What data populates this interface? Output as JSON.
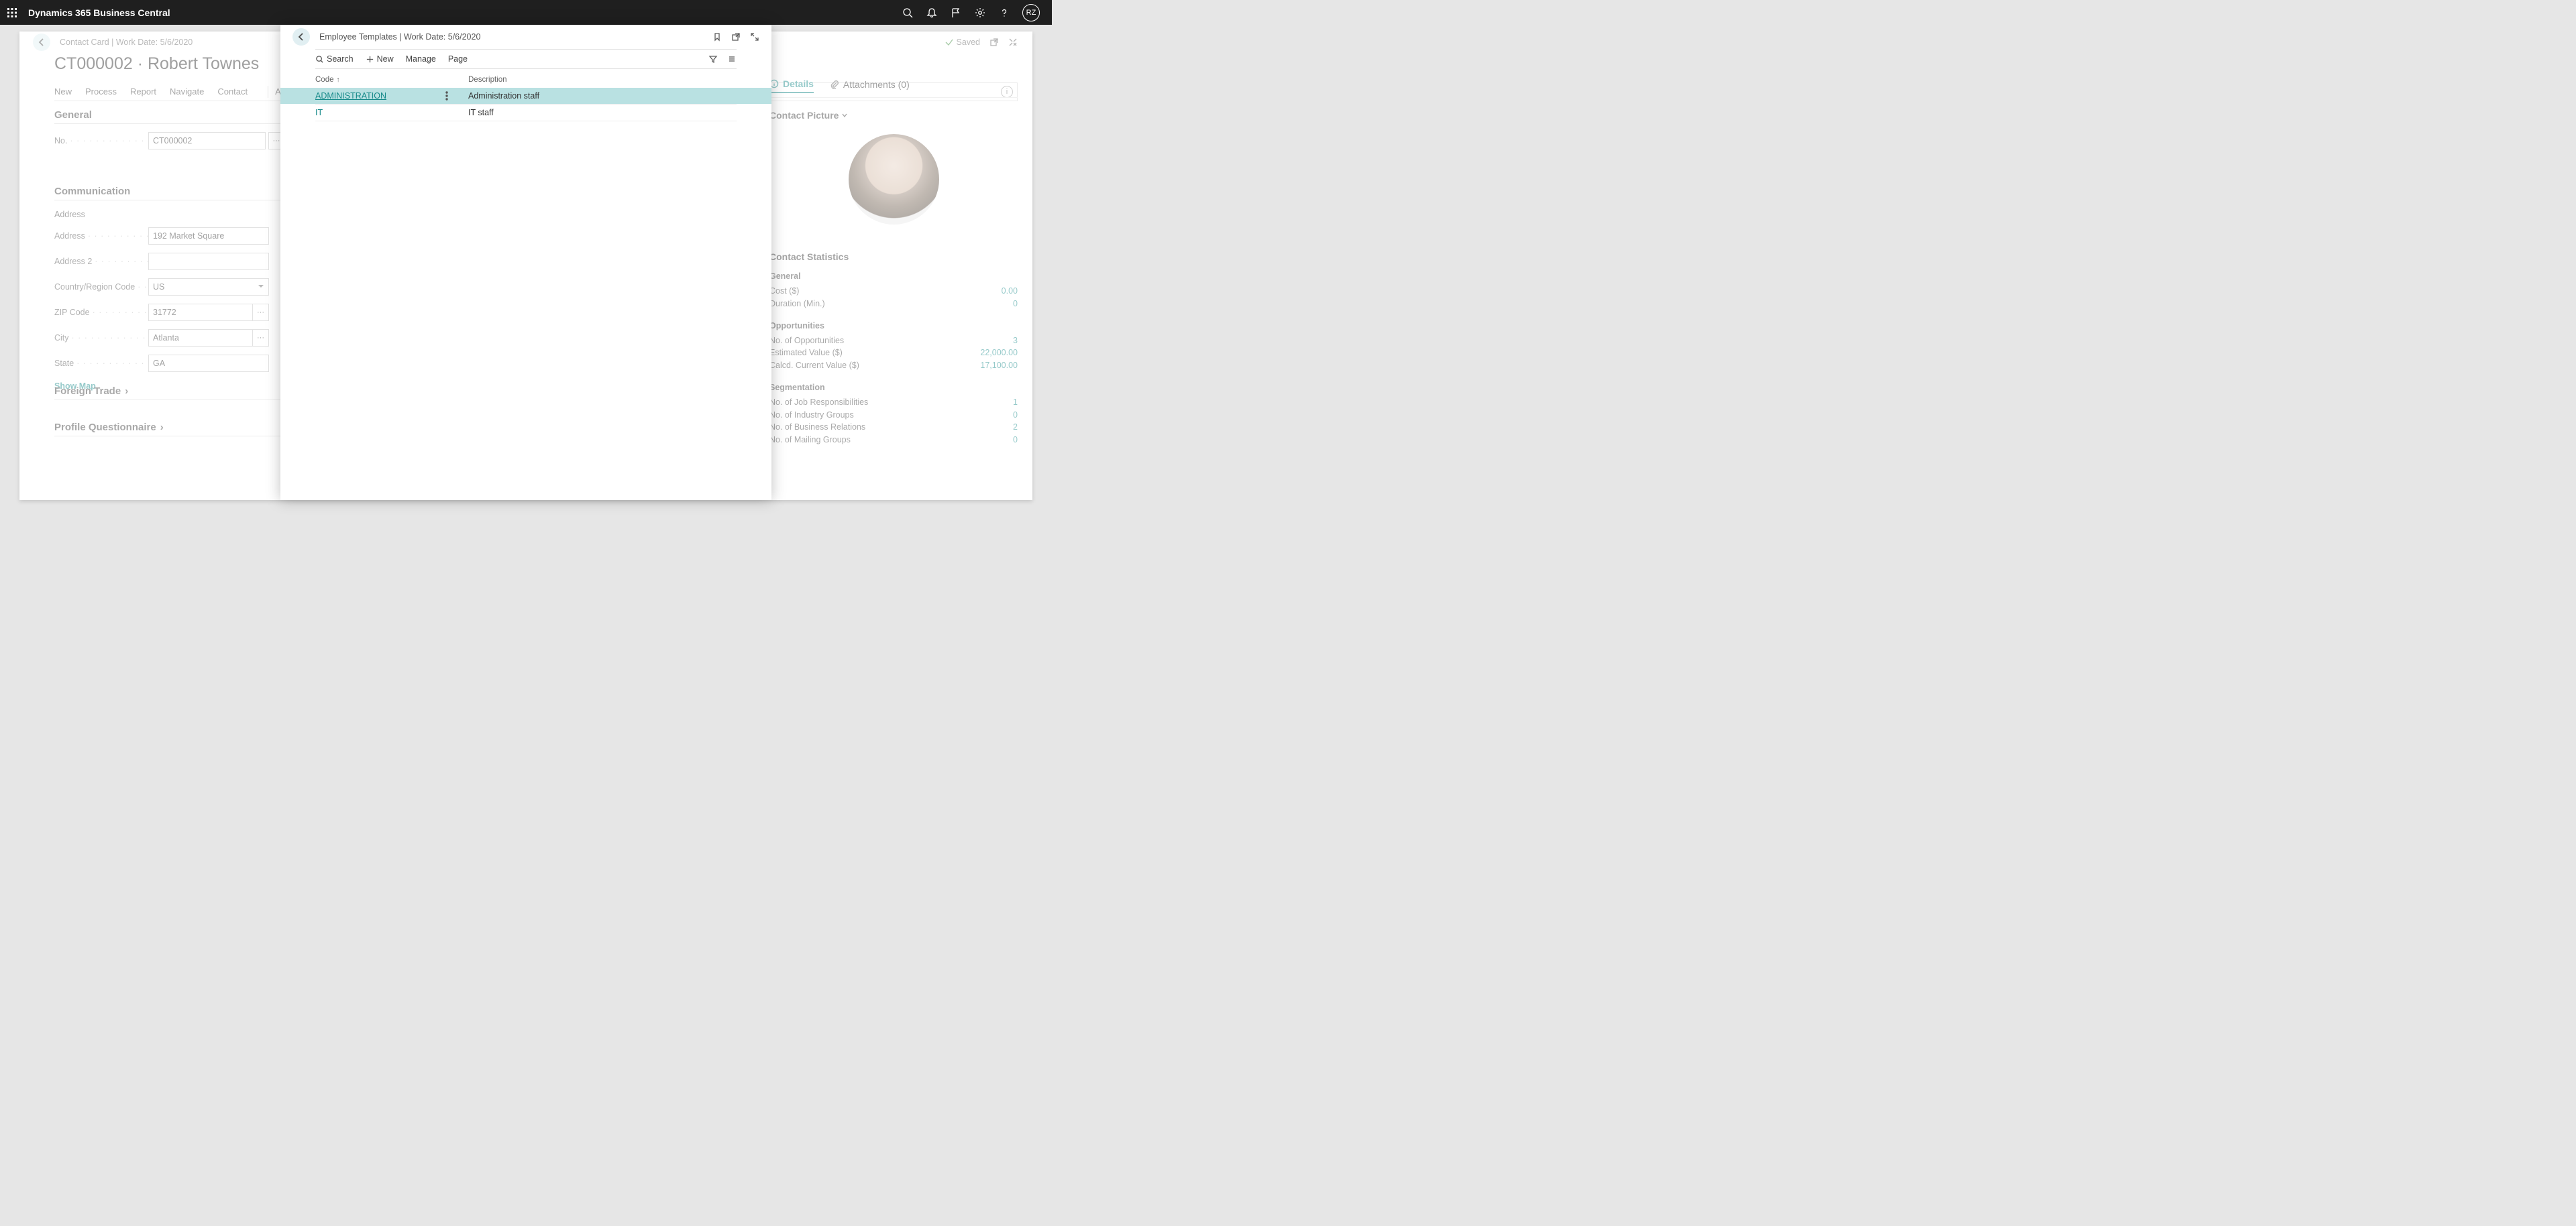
{
  "app_title": "Dynamics 365 Business Central",
  "user_initials": "RZ",
  "card": {
    "breadcrumb": "Contact Card | Work Date: 5/6/2020",
    "saved_label": "Saved",
    "title": "CT000002 · Robert Townes",
    "tabs": [
      "New",
      "Process",
      "Report",
      "Navigate",
      "Contact",
      "Actions"
    ],
    "general": {
      "title": "General",
      "no_label": "No.",
      "no_value": "CT000002"
    },
    "communication": {
      "title": "Communication",
      "address_header": "Address",
      "fields": {
        "address_label": "Address",
        "address_value": "192 Market Square",
        "address2_label": "Address 2",
        "address2_value": "",
        "country_label": "Country/Region Code",
        "country_value": "US",
        "zip_label": "ZIP Code",
        "zip_value": "31772",
        "city_label": "City",
        "city_value": "Atlanta",
        "state_label": "State",
        "state_value": "GA"
      },
      "show_map": "Show Map"
    },
    "foreign_trade": "Foreign Trade",
    "profile_q": "Profile Questionnaire"
  },
  "right": {
    "details_label": "Details",
    "attachments_label": "Attachments (0)",
    "picture_title": "Contact Picture",
    "stats_title": "Contact Statistics",
    "groups": [
      {
        "title": "General",
        "rows": [
          {
            "label": "Cost ($)",
            "value": "0.00"
          },
          {
            "label": "Duration (Min.)",
            "value": "0"
          }
        ]
      },
      {
        "title": "Opportunities",
        "rows": [
          {
            "label": "No. of Opportunities",
            "value": "3"
          },
          {
            "label": "Estimated Value ($)",
            "value": "22,000.00"
          },
          {
            "label": "Calcd. Current Value ($)",
            "value": "17,100.00"
          }
        ]
      },
      {
        "title": "Segmentation",
        "rows": [
          {
            "label": "No. of Job Responsibilities",
            "value": "1"
          },
          {
            "label": "No. of Industry Groups",
            "value": "0"
          },
          {
            "label": "No. of Business Relations",
            "value": "2"
          },
          {
            "label": "No. of Mailing Groups",
            "value": "0"
          }
        ]
      }
    ]
  },
  "modal": {
    "breadcrumb": "Employee Templates | Work Date: 5/6/2020",
    "toolbar": {
      "search": "Search",
      "new": "New",
      "manage": "Manage",
      "page": "Page"
    },
    "columns": [
      "Code",
      "Description"
    ],
    "rows": [
      {
        "code": "ADMINISTRATION",
        "desc": "Administration staff",
        "selected": true
      },
      {
        "code": "IT",
        "desc": "IT staff",
        "selected": false
      }
    ]
  }
}
